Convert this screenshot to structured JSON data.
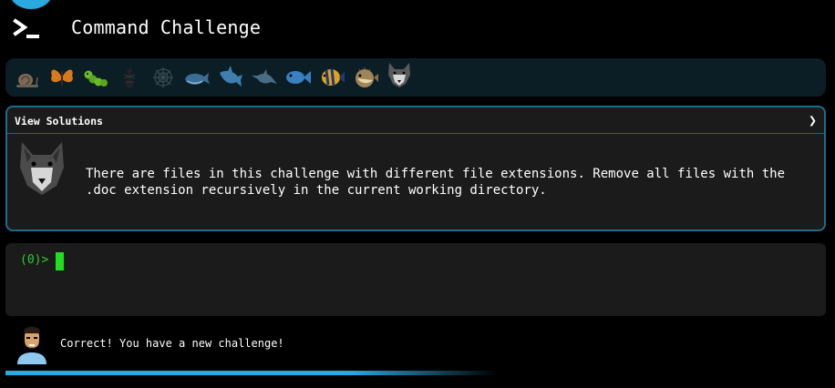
{
  "app": {
    "title": "Command Challenge",
    "logo_icon": "terminal-prompt-icon",
    "accent_color": "#2aa8e0"
  },
  "levels": [
    {
      "name": "snail",
      "icon": "snail-icon",
      "state": "completed"
    },
    {
      "name": "butterfly",
      "icon": "butterfly-icon",
      "state": "completed"
    },
    {
      "name": "caterpillar",
      "icon": "caterpillar-icon",
      "state": "completed"
    },
    {
      "name": "ant",
      "icon": "ant-icon",
      "state": "locked"
    },
    {
      "name": "spider-web",
      "icon": "spider-web-icon",
      "state": "locked"
    },
    {
      "name": "whale",
      "icon": "whale-icon",
      "state": "locked"
    },
    {
      "name": "shark",
      "icon": "shark-icon",
      "state": "locked"
    },
    {
      "name": "dolphin",
      "icon": "dolphin-icon",
      "state": "locked"
    },
    {
      "name": "fish",
      "icon": "fish-icon",
      "state": "locked"
    },
    {
      "name": "tropical-fish",
      "icon": "tropical-fish-icon",
      "state": "completed"
    },
    {
      "name": "blowfish",
      "icon": "blowfish-icon",
      "state": "completed"
    },
    {
      "name": "wolf",
      "icon": "wolf-icon",
      "state": "current"
    }
  ],
  "panel": {
    "header_label": "View Solutions",
    "expand_glyph": "❯",
    "challenge_text": "There are files in this challenge with different file extensions. Remove all files with the\n.doc extension recursively in the current working directory."
  },
  "terminal": {
    "prompt": "(0)>",
    "input_value": ""
  },
  "message": {
    "text": "Correct! You have a new challenge!"
  },
  "progress": {
    "fraction": 0.6
  }
}
